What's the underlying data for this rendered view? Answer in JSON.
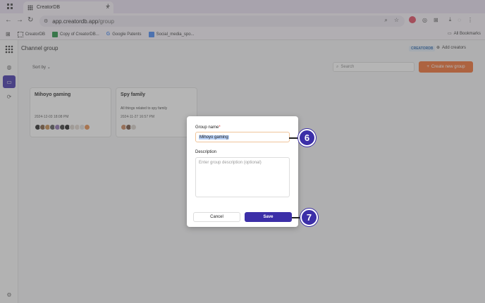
{
  "browser": {
    "tab_title": "CreatorDB",
    "tab_close": "×",
    "new_tab": "+",
    "url_host": "app.creatordb.app",
    "url_path": "/group",
    "bookmarks": [
      "CreatorDB",
      "Copy of CreatorDB...",
      "Google Patents",
      "Social_media_spo..."
    ],
    "all_bookmarks": "All Bookmarks"
  },
  "app": {
    "page_title": "Channel group",
    "brand_badge": "CREATORDB",
    "add_creators": "Add creators",
    "sort_by": "Sort by",
    "search_placeholder": "Search",
    "create_button": "Create new group",
    "cards": [
      {
        "title": "Mihoyo gaming",
        "description": "",
        "date": "2024-12-03 18:08 PM"
      },
      {
        "title": "Spy family",
        "description": "All things related to spy family",
        "date": "2024-11-27 16:57 PM"
      }
    ]
  },
  "modal": {
    "group_name_label": "Group name",
    "required_mark": "*",
    "group_name_value": "Mihoyo gaming",
    "description_label": "Description",
    "description_placeholder": "Enter group description (optional)",
    "cancel": "Cancel",
    "save": "Save"
  },
  "callouts": [
    "6",
    "7"
  ],
  "colors": {
    "accent": "#3c2fa8",
    "create": "#f06a2a"
  }
}
